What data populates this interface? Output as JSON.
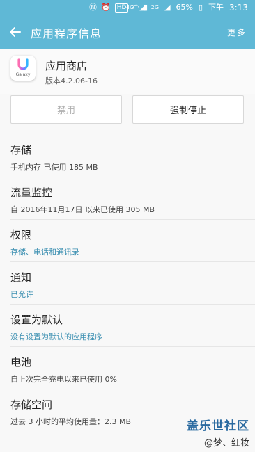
{
  "status_bar": {
    "hd": "HD",
    "network": "4G",
    "network2": "2G",
    "battery": "65%",
    "ampm": "下午",
    "time": "3:13"
  },
  "appbar": {
    "title": "应用程序信息",
    "more": "更多"
  },
  "app": {
    "icon_brand": "Galaxy",
    "name": "应用商店",
    "version": "版本4.2.06-16"
  },
  "buttons": {
    "disable": "禁用",
    "force_stop": "强制停止"
  },
  "sections": [
    {
      "title": "存储",
      "subtitle": "手机内存 已使用 185 MB",
      "accent": false
    },
    {
      "title": "流量监控",
      "subtitle": "自 2016年11月17日 以来已使用 305 MB",
      "accent": false
    },
    {
      "title": "权限",
      "subtitle": "存储、电话和通讯录",
      "accent": true
    },
    {
      "title": "通知",
      "subtitle": "已允许",
      "accent": true
    },
    {
      "title": "设置为默认",
      "subtitle": "没有设置为默认的应用程序",
      "accent": true
    },
    {
      "title": "电池",
      "subtitle": "自上次完全充电以来已使用 0%",
      "accent": false
    },
    {
      "title": "存储空间",
      "subtitle": "过去 3 小时的平均使用量：2.3 MB",
      "accent": false
    }
  ],
  "watermark": {
    "line1": "盖乐世社区",
    "line2": "@梦、红妆"
  }
}
